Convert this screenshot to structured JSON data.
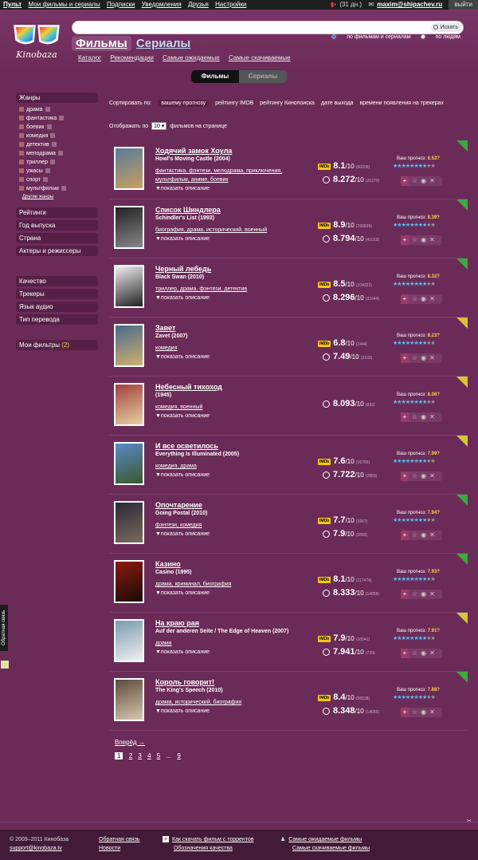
{
  "topbar": {
    "left": [
      "Пульт",
      "Мои фильмы и сериалы",
      "Подписки",
      "Уведомления",
      "Друзья",
      "Настройки"
    ],
    "days": "(31 дн.)",
    "user": "maxim@shipachev.ru",
    "exit": "выйти"
  },
  "header": {
    "logo_text": "Kinobaza",
    "search_button": "Искать",
    "radio_films": "по фильмам и сериалам",
    "radio_people": "по людям",
    "tab_films": "Фильмы",
    "tab_series": "Сериалы",
    "subnav": [
      "Каталог",
      "Рекомендации",
      "Самые ожидаемые",
      "Самые скачиваемые"
    ],
    "toggle_a": "Фильмы",
    "toggle_b": "Сериалы"
  },
  "sidebar": {
    "genres_title": "Жанры",
    "genres": [
      "драма",
      "фантастика",
      "боевик",
      "комедия",
      "детектив",
      "мелодрама",
      "триллер",
      "ужасы",
      "спорт",
      "мультфильм"
    ],
    "other_genres": "Другие жанры",
    "sections1": [
      "Рейтинги",
      "Год выпуска",
      "Страна",
      "Актеры и режиссеры"
    ],
    "sections2": [
      "Качество",
      "Трекеры",
      "Язык аудио",
      "Тип перевода"
    ],
    "my_filters": "Мои фильтры",
    "my_filters_count": "(2)"
  },
  "sort": {
    "label": "Сортировать по:",
    "options": [
      "вашему прогнозу",
      "рейтингу IMDB",
      "рейтингу Кинопоиска",
      "дате выхода",
      "времени появления на трекерах"
    ],
    "show_prefix": "Отображать по",
    "show_value": "10",
    "show_suffix": "фильмов на странице"
  },
  "labels": {
    "show_desc": "▼показать описание",
    "forecast": "Ваш прогноз:",
    "imdb_badge": "IMDb",
    "ten": "/10"
  },
  "movies": [
    {
      "title": "Ходячий замок Хоула",
      "orig": "Howl's Moving Castle (2004)",
      "genres": "фантастика, фэнтези, мелодрама, приключения, мультфильм, аниме, боевик",
      "imdb": "8.1",
      "imdb_votes": "(50206)",
      "kp": "8.272",
      "kp_votes": "(25370)",
      "forecast": "8.53?",
      "stars": 8,
      "badge": "g",
      "colors": [
        "#5a7a9a",
        "#c8a060"
      ]
    },
    {
      "title": "Список Шиндлера",
      "orig": "Schindler's List (1993)",
      "genres": "биография, драма, исторический, военный",
      "imdb": "8.9",
      "imdb_votes": "(299839)",
      "kp": "8.794",
      "kp_votes": "(41019)",
      "forecast": "8.39?",
      "stars": 8,
      "badge": "g",
      "colors": [
        "#222",
        "#888"
      ]
    },
    {
      "title": "Черный лебедь",
      "orig": "Black Swan (2010)",
      "genres": "триллер, драма, фэнтези, детектив",
      "imdb": "8.5",
      "imdb_votes": "(104322)",
      "kp": "8.296",
      "kp_votes": "(31644)",
      "forecast": "8.32?",
      "stars": 8,
      "badge": "g",
      "colors": [
        "#eee",
        "#222"
      ]
    },
    {
      "title": "Завет",
      "orig": "Zavet (2007)",
      "genres": "комедия",
      "imdb": "6.8",
      "imdb_votes": "(2444)",
      "kp": "7.49",
      "kp_votes": "(2103)",
      "forecast": "8.23?",
      "stars": 8,
      "badge": "y",
      "colors": [
        "#4a6a8a",
        "#d0b070"
      ]
    },
    {
      "title": "Небесный тихоход",
      "orig": "(1945)",
      "genres": "комедия, военный",
      "imdb": "",
      "imdb_votes": "",
      "kp": "8.093",
      "kp_votes": "(832)",
      "forecast": "8.06?",
      "stars": 8,
      "badge": "y",
      "colors": [
        "#a04040",
        "#e8d0a0"
      ]
    },
    {
      "title": "И все осветилось",
      "orig": "Everything Is Illuminated (2005)",
      "genres": "комедия, драма",
      "imdb": "7.6",
      "imdb_votes": "(26766)",
      "kp": "7.722",
      "kp_votes": "(2859)",
      "forecast": "7.99?",
      "stars": 8,
      "badge": "y",
      "colors": [
        "#5a88c8",
        "#3a5a2a"
      ]
    },
    {
      "title": "Опочтарение",
      "orig": "Going Postal (2010)",
      "genres": "фэнтези, комедия",
      "imdb": "7.7",
      "imdb_votes": "(1667)",
      "kp": "7.9",
      "kp_votes": "(1890)",
      "forecast": "7.94?",
      "stars": 8,
      "badge": "g",
      "colors": [
        "#2a2a3a",
        "#7a6a5a"
      ]
    },
    {
      "title": "Казино",
      "orig": "Casino (1995)",
      "genres": "драма, криминал, биография",
      "imdb": "8.1",
      "imdb_votes": "(117474)",
      "kp": "8.333",
      "kp_votes": "(14858)",
      "forecast": "7.93?",
      "stars": 8,
      "badge": "g",
      "colors": [
        "#8a1a10",
        "#1a0a08"
      ]
    },
    {
      "title": "На краю рая",
      "orig": "Auf der anderen Seite / The Edge of Heaven (2007)",
      "genres": "драма",
      "imdb": "7.9",
      "imdb_votes": "(10541)",
      "kp": "7.941",
      "kp_votes": "(720)",
      "forecast": "7.91?",
      "stars": 8,
      "badge": "y",
      "colors": [
        "#7a9ab0",
        "#f0f0f0"
      ]
    },
    {
      "title": "Король говорит!",
      "orig": "The King's Speech (2010)",
      "genres": "драма, исторический, биография",
      "imdb": "8.4",
      "imdb_votes": "(58538)",
      "kp": "8.348",
      "kp_votes": "(14056)",
      "forecast": "7.88?",
      "stars": 8,
      "badge": "g",
      "colors": [
        "#5a4a3a",
        "#d8c8b0"
      ]
    }
  ],
  "pager": {
    "next": "Вперёд →",
    "pages": [
      "1",
      "2",
      "3",
      "4",
      "5",
      "...",
      "9"
    ]
  },
  "feedback_tab": "Обратная связь",
  "footer": {
    "copyright": "© 2009–2011 Кинобаза",
    "email": "support@kinobaza.tv",
    "col2": [
      "Обратная связь",
      "Новости"
    ],
    "col3": [
      "Как скачать фильм с торрентов",
      "Обозначения качества"
    ],
    "col4": [
      "Самые ожидаемые фильмы",
      "Самые скачиваемые фильмы"
    ]
  }
}
